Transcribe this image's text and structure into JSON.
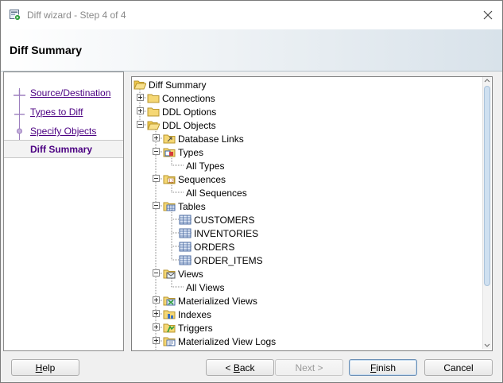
{
  "window": {
    "title": "Diff wizard - Step 4 of 4",
    "app_icon": "wizard-app-icon",
    "close_icon": "close-icon"
  },
  "header": {
    "title": "Diff Summary"
  },
  "steps": [
    {
      "label": "Source/Destination",
      "state": "link"
    },
    {
      "label": "Types to Diff",
      "state": "link"
    },
    {
      "label": "Specify Objects",
      "state": "link"
    },
    {
      "label": "Diff Summary",
      "state": "current"
    }
  ],
  "tree": [
    {
      "label": "Diff Summary",
      "icon": "folder-open",
      "level": 0,
      "expander": "none"
    },
    {
      "label": "Connections",
      "icon": "folder",
      "level": 1,
      "expander": "plus"
    },
    {
      "label": "DDL Options",
      "icon": "folder",
      "level": 1,
      "expander": "plus"
    },
    {
      "label": "DDL Objects",
      "icon": "folder-open",
      "level": 1,
      "expander": "minus"
    },
    {
      "label": "Database Links",
      "icon": "folder-link",
      "level": 2,
      "expander": "plus"
    },
    {
      "label": "Types",
      "icon": "folder-types",
      "level": 2,
      "expander": "minus"
    },
    {
      "label": "All Types",
      "icon": "none",
      "level": 3,
      "expander": "none"
    },
    {
      "label": "Sequences",
      "icon": "folder-sequence",
      "level": 2,
      "expander": "minus"
    },
    {
      "label": "All Sequences",
      "icon": "none",
      "level": 3,
      "expander": "none"
    },
    {
      "label": "Tables",
      "icon": "folder-table",
      "level": 2,
      "expander": "minus"
    },
    {
      "label": "CUSTOMERS",
      "icon": "table",
      "level": 3,
      "expander": "none"
    },
    {
      "label": "INVENTORIES",
      "icon": "table",
      "level": 3,
      "expander": "none"
    },
    {
      "label": "ORDERS",
      "icon": "table",
      "level": 3,
      "expander": "none"
    },
    {
      "label": "ORDER_ITEMS",
      "icon": "table",
      "level": 3,
      "expander": "none"
    },
    {
      "label": "Views",
      "icon": "folder-view",
      "level": 2,
      "expander": "minus"
    },
    {
      "label": "All Views",
      "icon": "none",
      "level": 3,
      "expander": "none"
    },
    {
      "label": "Materialized Views",
      "icon": "folder-mview",
      "level": 2,
      "expander": "plus"
    },
    {
      "label": "Indexes",
      "icon": "folder-index",
      "level": 2,
      "expander": "plus"
    },
    {
      "label": "Triggers",
      "icon": "folder-trigger",
      "level": 2,
      "expander": "plus"
    },
    {
      "label": "Materialized View Logs",
      "icon": "folder-mviewlog",
      "level": 2,
      "expander": "plus"
    }
  ],
  "buttons": {
    "help": {
      "label": "Help",
      "mnemonic": "H",
      "rest": "elp"
    },
    "back": {
      "prefix": "< ",
      "mnemonic": "B",
      "rest": "ack"
    },
    "next": {
      "label": "Next >"
    },
    "finish": {
      "mnemonic": "F",
      "rest": "inish"
    },
    "cancel": {
      "label": "Cancel"
    }
  },
  "colors": {
    "accent_link": "#4b0082",
    "tree_folder": "#f5d774",
    "header_gradient_end": "#d8e2ea"
  }
}
